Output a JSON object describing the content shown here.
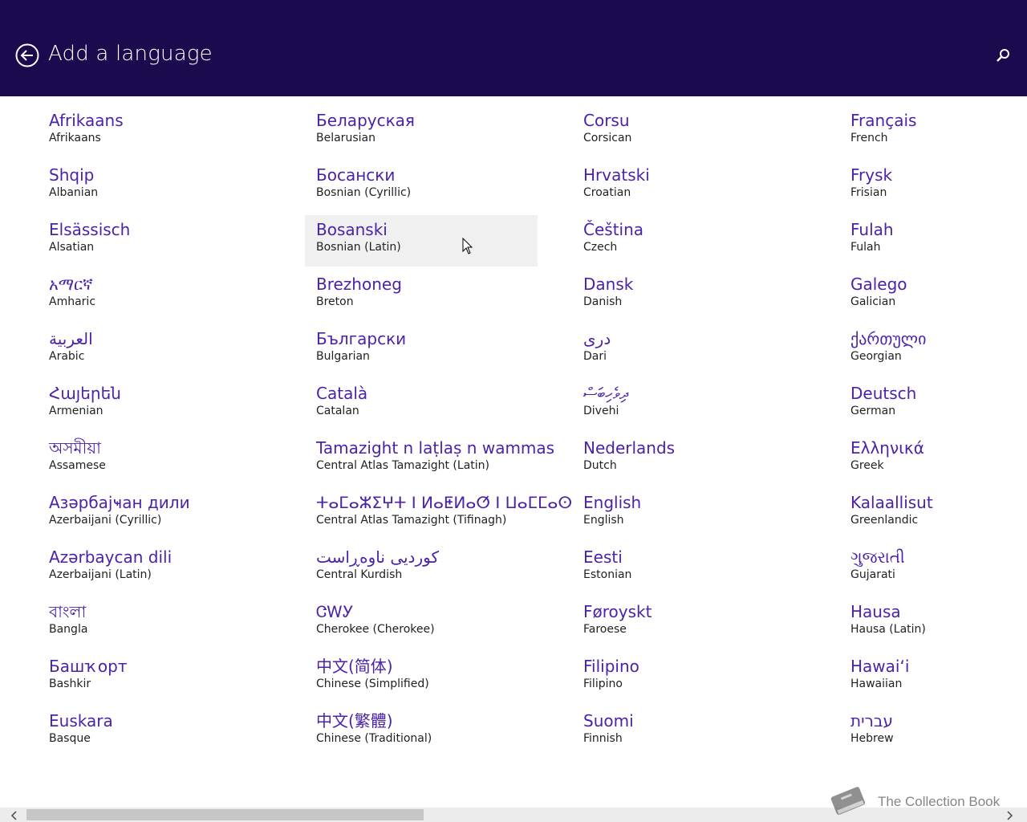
{
  "header": {
    "title": "Add a language",
    "back_icon": "back-arrow-icon",
    "search_icon": "search-icon"
  },
  "columns": [
    [
      {
        "native": "Afrikaans",
        "english": "Afrikaans"
      },
      {
        "native": "Shqip",
        "english": "Albanian"
      },
      {
        "native": "Elsässisch",
        "english": "Alsatian"
      },
      {
        "native": "አማርኛ",
        "english": "Amharic"
      },
      {
        "native": "العربية",
        "english": "Arabic"
      },
      {
        "native": "Հայերեն",
        "english": "Armenian"
      },
      {
        "native": "অসমীয়া",
        "english": "Assamese"
      },
      {
        "native": "Азәрбајҹан дили",
        "english": "Azerbaijani (Cyrillic)"
      },
      {
        "native": "Azərbaycan dili",
        "english": "Azerbaijani (Latin)"
      },
      {
        "native": "বাংলা",
        "english": "Bangla"
      },
      {
        "native": "Башҡорт",
        "english": "Bashkir"
      },
      {
        "native": "Euskara",
        "english": "Basque"
      }
    ],
    [
      {
        "native": "Беларуская",
        "english": "Belarusian"
      },
      {
        "native": "Босански",
        "english": "Bosnian (Cyrillic)"
      },
      {
        "native": "Bosanski",
        "english": "Bosnian (Latin)",
        "selected": true
      },
      {
        "native": "Brezhoneg",
        "english": "Breton"
      },
      {
        "native": "Български",
        "english": "Bulgarian"
      },
      {
        "native": "Català",
        "english": "Catalan"
      },
      {
        "native": "Tamazight n laṭlaṣ n wammas",
        "english": "Central Atlas Tamazight (Latin)"
      },
      {
        "native": "ⵜⴰⵎⴰⵣⵉⵖⵜ ⵏ ⵍⴰⵟⵍⴰⵚ ⵏ ⵡⴰⵎⵎⴰⵙ",
        "english": "Central Atlas Tamazight (Tifinagh)"
      },
      {
        "native": "کوردیی ناوەڕاست",
        "english": "Central Kurdish"
      },
      {
        "native": "ᏣᎳᎩ",
        "english": "Cherokee (Cherokee)"
      },
      {
        "native": "中文(简体)",
        "english": "Chinese (Simplified)"
      },
      {
        "native": "中文(繁體)",
        "english": "Chinese (Traditional)"
      }
    ],
    [
      {
        "native": "Corsu",
        "english": "Corsican"
      },
      {
        "native": "Hrvatski",
        "english": "Croatian"
      },
      {
        "native": "Čeština",
        "english": "Czech"
      },
      {
        "native": "Dansk",
        "english": "Danish"
      },
      {
        "native": "درى",
        "english": "Dari"
      },
      {
        "native": "ދިވެހިބަސް",
        "english": "Divehi"
      },
      {
        "native": "Nederlands",
        "english": "Dutch"
      },
      {
        "native": "English",
        "english": "English"
      },
      {
        "native": "Eesti",
        "english": "Estonian"
      },
      {
        "native": "Føroyskt",
        "english": "Faroese"
      },
      {
        "native": "Filipino",
        "english": "Filipino"
      },
      {
        "native": "Suomi",
        "english": "Finnish"
      }
    ],
    [
      {
        "native": "Français",
        "english": "French"
      },
      {
        "native": "Frysk",
        "english": "Frisian"
      },
      {
        "native": "Fulah",
        "english": "Fulah"
      },
      {
        "native": "Galego",
        "english": "Galician"
      },
      {
        "native": "ქართული",
        "english": "Georgian"
      },
      {
        "native": "Deutsch",
        "english": "German"
      },
      {
        "native": "Ελληνικά",
        "english": "Greek"
      },
      {
        "native": "Kalaallisut",
        "english": "Greenlandic"
      },
      {
        "native": "ગુજરાતી",
        "english": "Gujarati"
      },
      {
        "native": "Hausa",
        "english": "Hausa (Latin)"
      },
      {
        "native": "Hawaiʻi",
        "english": "Hawaiian"
      },
      {
        "native": "עברית",
        "english": "Hebrew"
      }
    ]
  ],
  "watermark": {
    "text": "The Collection Book",
    "icon": "book-icon"
  },
  "colors": {
    "header_bg": "#1c0a4f",
    "link": "#4b22a8",
    "selected_bg": "#f0f0f0"
  }
}
